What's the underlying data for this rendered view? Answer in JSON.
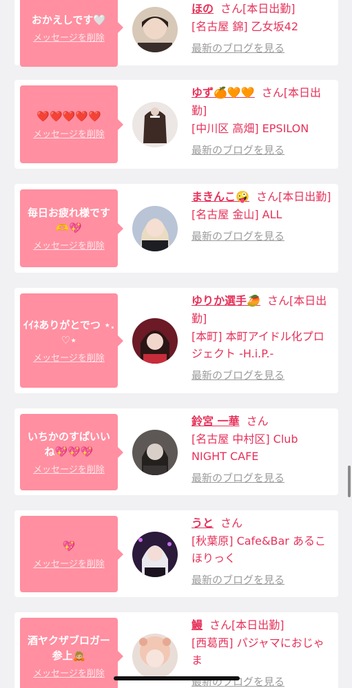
{
  "cards": [
    {
      "message": "おかえしです🤍",
      "delete_label": "メッセージを削除",
      "name": "ほの",
      "san": "さん",
      "status": "[本日出勤]",
      "shop": "[名古屋 錦] 乙女坂42",
      "blog": "最新のブログを見る",
      "avatar": "avatar-photo-icon"
    },
    {
      "message": "❤️❤️❤️❤️❤️",
      "delete_label": "メッセージを削除",
      "name": "ゆず🍊🧡🧡",
      "san": "さん",
      "status": "[本日出勤]",
      "shop": "[中川区 高畑] EPSILON",
      "blog": "最新のブログを見る",
      "avatar": "avatar-photo-icon"
    },
    {
      "message": "毎日お疲れ様です🫶💖",
      "delete_label": "メッセージを削除",
      "name": "まきんこ🤪",
      "san": "さん",
      "status": "[本日出勤]",
      "shop": "[名古屋 金山] ALL",
      "blog": "最新のブログを見る",
      "avatar": "avatar-photo-icon"
    },
    {
      "message": "ｲｲﾈありがとでつ ⋆.♡⋆",
      "delete_label": "メッセージを削除",
      "name": "ゆりか選手🥭",
      "san": "さん",
      "status": "[本日出勤]",
      "shop": "[本町] 本町アイドル化プロジェクト -H.i.P.-",
      "blog": "最新のブログを見る",
      "avatar": "avatar-photo-icon"
    },
    {
      "message": "いちかのすぱいいね💖💖💖",
      "delete_label": "メッセージを削除",
      "name": "鈴宮 一華",
      "san": "さん",
      "status": "",
      "shop": "[名古屋 中村区] Club NIGHT CAFE",
      "blog": "最新のブログを見る",
      "avatar": "avatar-photo-icon"
    },
    {
      "message": "💖",
      "delete_label": "メッセージを削除",
      "name": "うと",
      "san": "さん",
      "status": "",
      "shop": "[秋葉原] Cafe&Bar あるこほりっく",
      "blog": "最新のブログを見る",
      "avatar": "avatar-photo-icon"
    },
    {
      "message": "酒ヤクザブロガー参上🙇🏼",
      "delete_label": "メッセージを削除",
      "name": "鰻",
      "san": "さん",
      "status": "[本日出勤]",
      "shop": "[西葛西] パジャマにおじゃま",
      "blog": "最新のブログを見る",
      "avatar": "avatar-photo-icon"
    }
  ],
  "colors": {
    "accent": "#e6325a",
    "bubble": "#ff8fa1",
    "background": "#f1f0f2",
    "link_gray": "#9b9b9b"
  }
}
